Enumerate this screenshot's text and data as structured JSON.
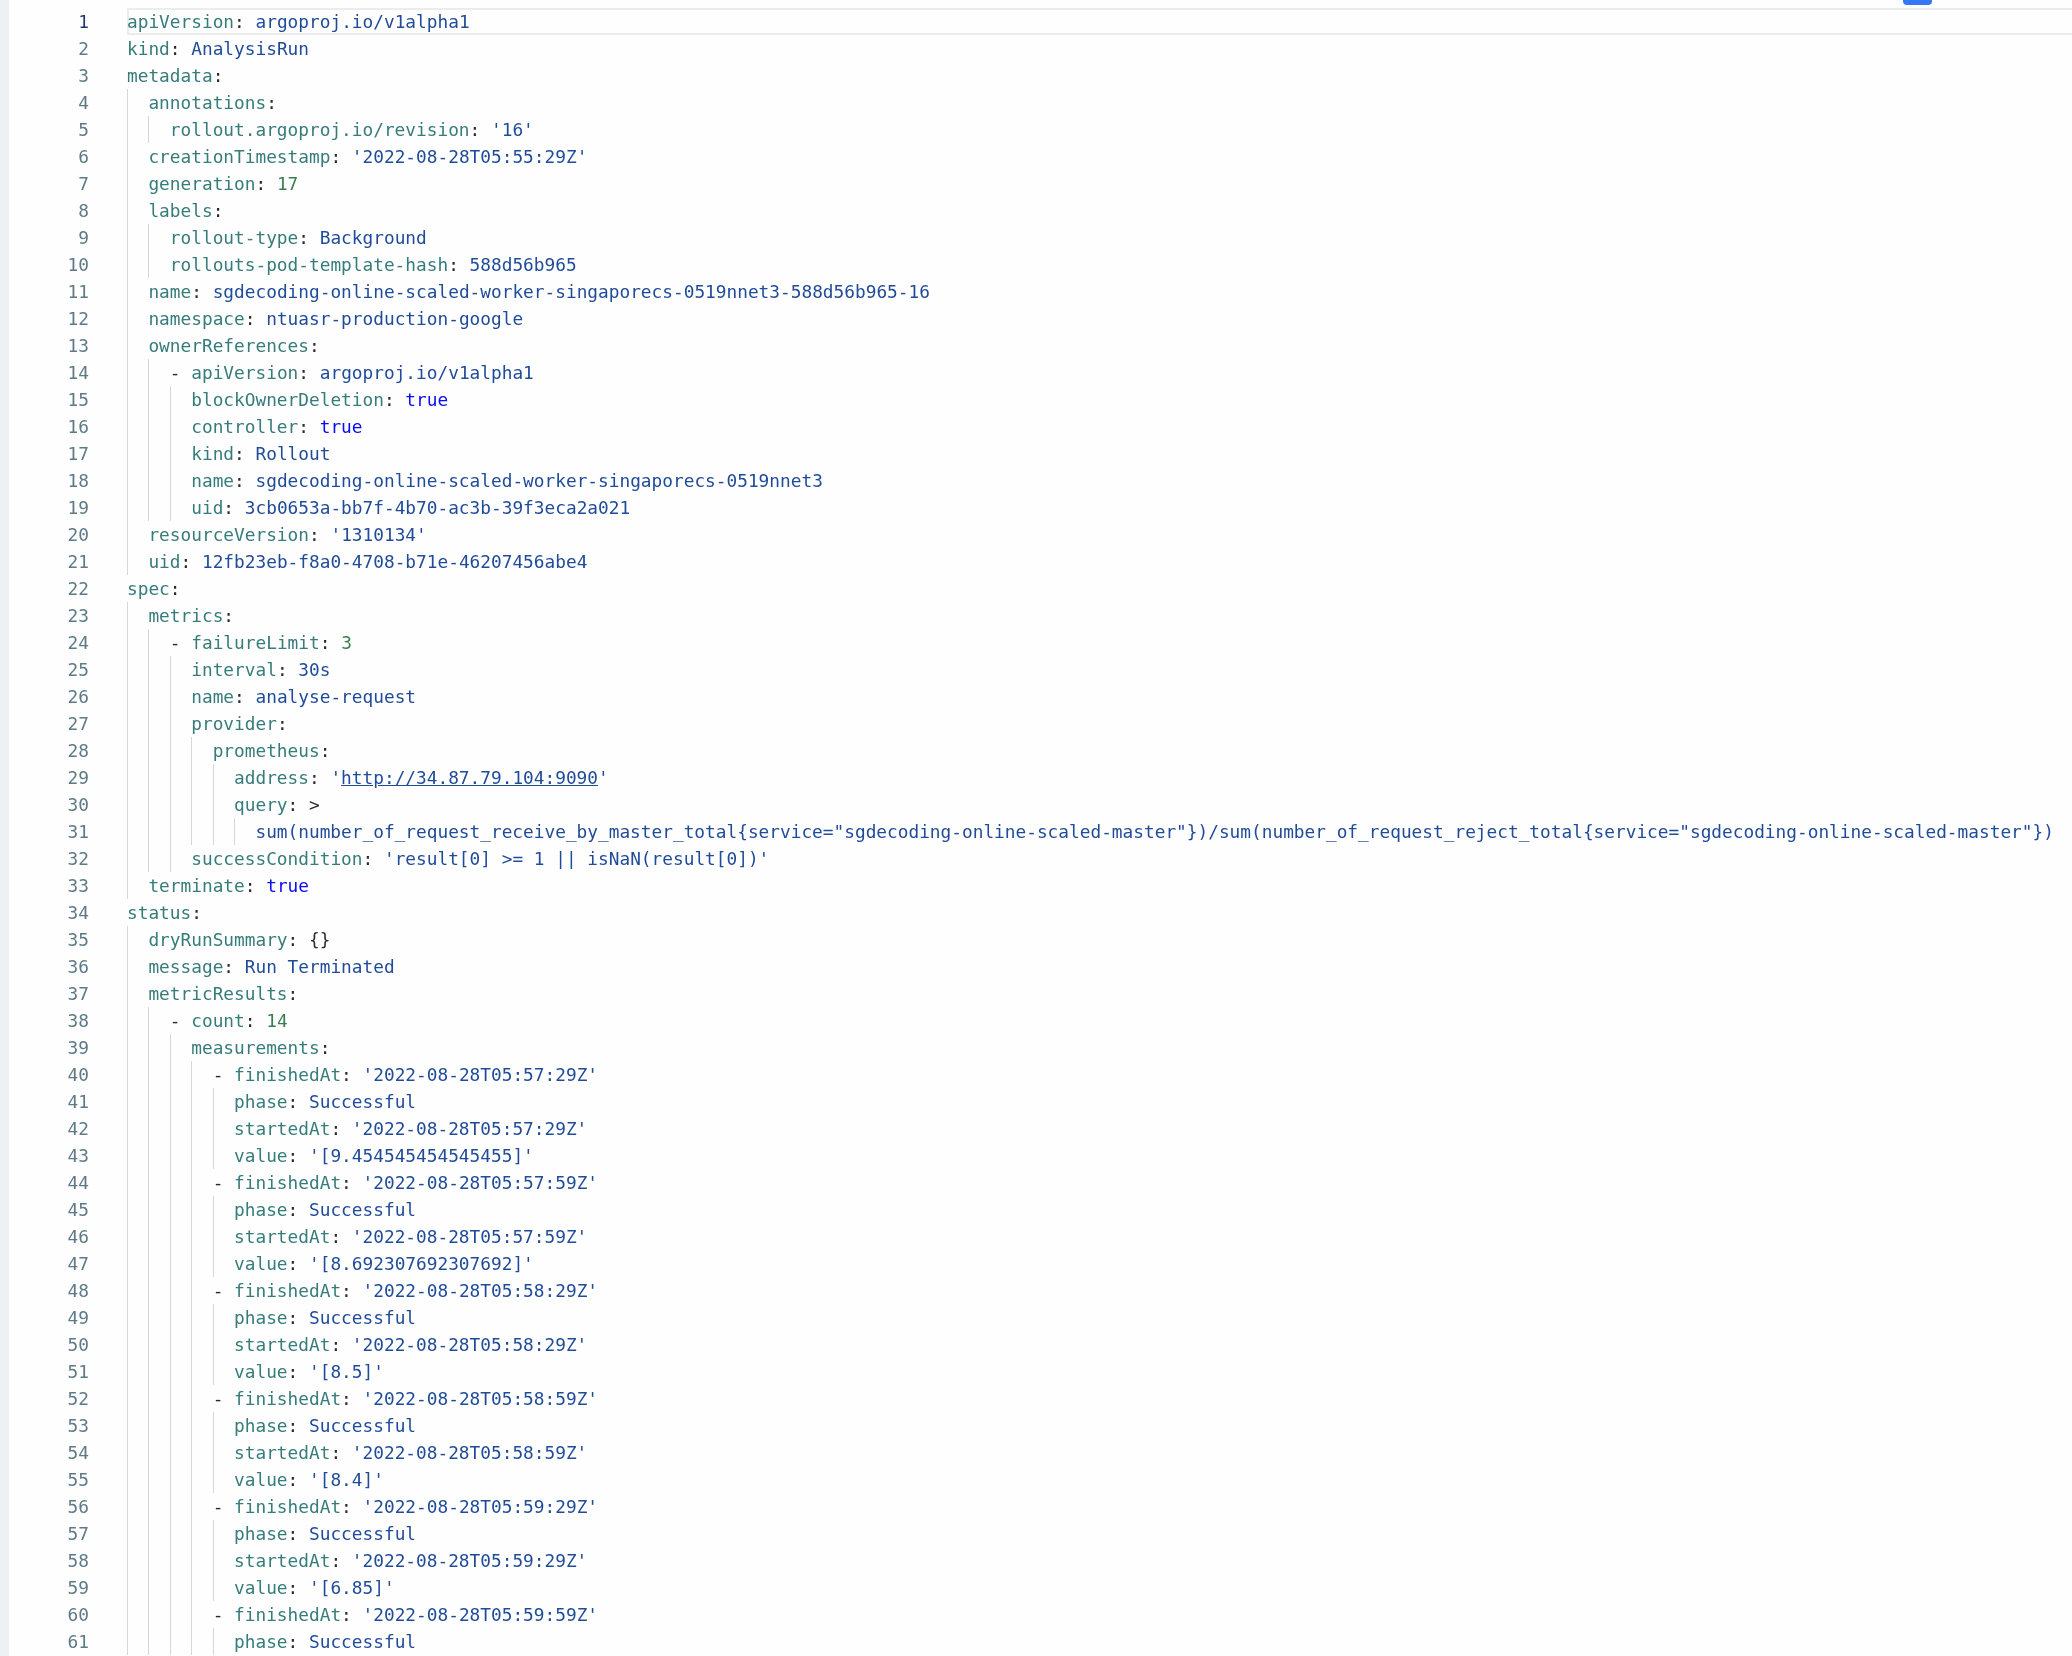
{
  "editor": {
    "lines": [
      {
        "number": "1",
        "selected": true,
        "tokens": [
          {
            "kind": "key",
            "text": "apiVersion"
          },
          {
            "kind": "punct",
            "text": ": "
          },
          {
            "kind": "string",
            "text": "argoproj.io/v1alpha1"
          }
        ]
      },
      {
        "number": "2",
        "selected": false,
        "tokens": [
          {
            "kind": "key",
            "text": "kind"
          },
          {
            "kind": "punct",
            "text": ": "
          },
          {
            "kind": "string",
            "text": "AnalysisRun"
          }
        ]
      },
      {
        "number": "3",
        "selected": false,
        "tokens": [
          {
            "kind": "key",
            "text": "metadata"
          },
          {
            "kind": "punct",
            "text": ":"
          }
        ]
      },
      {
        "number": "4",
        "selected": false,
        "tokens": [
          {
            "kind": "key",
            "text": "  annotations"
          },
          {
            "kind": "punct",
            "text": ":"
          }
        ]
      },
      {
        "number": "5",
        "selected": false,
        "tokens": [
          {
            "kind": "key",
            "text": "    rollout.argoproj.io/revision"
          },
          {
            "kind": "punct",
            "text": ": "
          },
          {
            "kind": "string",
            "text": "'16'"
          }
        ]
      },
      {
        "number": "6",
        "selected": false,
        "tokens": [
          {
            "kind": "key",
            "text": "  creationTimestamp"
          },
          {
            "kind": "punct",
            "text": ": "
          },
          {
            "kind": "string",
            "text": "'2022-08-28T05:55:29Z'"
          }
        ]
      },
      {
        "number": "7",
        "selected": false,
        "tokens": [
          {
            "kind": "key",
            "text": "  generation"
          },
          {
            "kind": "punct",
            "text": ": "
          },
          {
            "kind": "number",
            "text": "17"
          }
        ]
      },
      {
        "number": "8",
        "selected": false,
        "tokens": [
          {
            "kind": "key",
            "text": "  labels"
          },
          {
            "kind": "punct",
            "text": ":"
          }
        ]
      },
      {
        "number": "9",
        "selected": false,
        "tokens": [
          {
            "kind": "key",
            "text": "    rollout-type"
          },
          {
            "kind": "punct",
            "text": ": "
          },
          {
            "kind": "string",
            "text": "Background"
          }
        ]
      },
      {
        "number": "10",
        "selected": false,
        "tokens": [
          {
            "kind": "key",
            "text": "    rollouts-pod-template-hash"
          },
          {
            "kind": "punct",
            "text": ": "
          },
          {
            "kind": "string",
            "text": "588d56b965"
          }
        ]
      },
      {
        "number": "11",
        "selected": false,
        "tokens": [
          {
            "kind": "key",
            "text": "  name"
          },
          {
            "kind": "punct",
            "text": ": "
          },
          {
            "kind": "string",
            "text": "sgdecoding-online-scaled-worker-singaporecs-0519nnet3-588d56b965-16"
          }
        ]
      },
      {
        "number": "12",
        "selected": false,
        "tokens": [
          {
            "kind": "key",
            "text": "  namespace"
          },
          {
            "kind": "punct",
            "text": ": "
          },
          {
            "kind": "string",
            "text": "ntuasr-production-google"
          }
        ]
      },
      {
        "number": "13",
        "selected": false,
        "tokens": [
          {
            "kind": "key",
            "text": "  ownerReferences"
          },
          {
            "kind": "punct",
            "text": ":"
          }
        ]
      },
      {
        "number": "14",
        "selected": false,
        "tokens": [
          {
            "kind": "punct",
            "text": "    - "
          },
          {
            "kind": "key",
            "text": "apiVersion"
          },
          {
            "kind": "punct",
            "text": ": "
          },
          {
            "kind": "string",
            "text": "argoproj.io/v1alpha1"
          }
        ]
      },
      {
        "number": "15",
        "selected": false,
        "tokens": [
          {
            "kind": "key",
            "text": "      blockOwnerDeletion"
          },
          {
            "kind": "punct",
            "text": ": "
          },
          {
            "kind": "bool",
            "text": "true"
          }
        ]
      },
      {
        "number": "16",
        "selected": false,
        "tokens": [
          {
            "kind": "key",
            "text": "      controller"
          },
          {
            "kind": "punct",
            "text": ": "
          },
          {
            "kind": "bool",
            "text": "true"
          }
        ]
      },
      {
        "number": "17",
        "selected": false,
        "tokens": [
          {
            "kind": "key",
            "text": "      kind"
          },
          {
            "kind": "punct",
            "text": ": "
          },
          {
            "kind": "string",
            "text": "Rollout"
          }
        ]
      },
      {
        "number": "18",
        "selected": false,
        "tokens": [
          {
            "kind": "key",
            "text": "      name"
          },
          {
            "kind": "punct",
            "text": ": "
          },
          {
            "kind": "string",
            "text": "sgdecoding-online-scaled-worker-singaporecs-0519nnet3"
          }
        ]
      },
      {
        "number": "19",
        "selected": false,
        "tokens": [
          {
            "kind": "key",
            "text": "      uid"
          },
          {
            "kind": "punct",
            "text": ": "
          },
          {
            "kind": "string",
            "text": "3cb0653a-bb7f-4b70-ac3b-39f3eca2a021"
          }
        ]
      },
      {
        "number": "20",
        "selected": false,
        "tokens": [
          {
            "kind": "key",
            "text": "  resourceVersion"
          },
          {
            "kind": "punct",
            "text": ": "
          },
          {
            "kind": "string",
            "text": "'1310134'"
          }
        ]
      },
      {
        "number": "21",
        "selected": false,
        "tokens": [
          {
            "kind": "key",
            "text": "  uid"
          },
          {
            "kind": "punct",
            "text": ": "
          },
          {
            "kind": "string",
            "text": "12fb23eb-f8a0-4708-b71e-46207456abe4"
          }
        ]
      },
      {
        "number": "22",
        "selected": false,
        "tokens": [
          {
            "kind": "key",
            "text": "spec"
          },
          {
            "kind": "punct",
            "text": ":"
          }
        ]
      },
      {
        "number": "23",
        "selected": false,
        "tokens": [
          {
            "kind": "key",
            "text": "  metrics"
          },
          {
            "kind": "punct",
            "text": ":"
          }
        ]
      },
      {
        "number": "24",
        "selected": false,
        "tokens": [
          {
            "kind": "punct",
            "text": "    - "
          },
          {
            "kind": "key",
            "text": "failureLimit"
          },
          {
            "kind": "punct",
            "text": ": "
          },
          {
            "kind": "number",
            "text": "3"
          }
        ]
      },
      {
        "number": "25",
        "selected": false,
        "tokens": [
          {
            "kind": "key",
            "text": "      interval"
          },
          {
            "kind": "punct",
            "text": ": "
          },
          {
            "kind": "string",
            "text": "30s"
          }
        ]
      },
      {
        "number": "26",
        "selected": false,
        "tokens": [
          {
            "kind": "key",
            "text": "      name"
          },
          {
            "kind": "punct",
            "text": ": "
          },
          {
            "kind": "string",
            "text": "analyse-request"
          }
        ]
      },
      {
        "number": "27",
        "selected": false,
        "tokens": [
          {
            "kind": "key",
            "text": "      provider"
          },
          {
            "kind": "punct",
            "text": ":"
          }
        ]
      },
      {
        "number": "28",
        "selected": false,
        "tokens": [
          {
            "kind": "key",
            "text": "        prometheus"
          },
          {
            "kind": "punct",
            "text": ":"
          }
        ]
      },
      {
        "number": "29",
        "selected": false,
        "tokens": [
          {
            "kind": "key",
            "text": "          address"
          },
          {
            "kind": "punct",
            "text": ": "
          },
          {
            "kind": "string",
            "text": "'"
          },
          {
            "kind": "link",
            "text": "http://34.87.79.104:9090"
          },
          {
            "kind": "string",
            "text": "'"
          }
        ]
      },
      {
        "number": "30",
        "selected": false,
        "tokens": [
          {
            "kind": "key",
            "text": "          query"
          },
          {
            "kind": "punct",
            "text": ": >"
          }
        ]
      },
      {
        "number": "31",
        "selected": false,
        "tokens": [
          {
            "kind": "string",
            "text": "            sum(number_of_request_receive_by_master_total{service=\"sgdecoding-online-scaled-master\"})/sum(number_of_request_reject_total{service=\"sgdecoding-online-scaled-master\"})"
          }
        ]
      },
      {
        "number": "32",
        "selected": false,
        "tokens": [
          {
            "kind": "key",
            "text": "      successCondition"
          },
          {
            "kind": "punct",
            "text": ": "
          },
          {
            "kind": "string",
            "text": "'result[0] >= 1 || isNaN(result[0])'"
          }
        ]
      },
      {
        "number": "33",
        "selected": false,
        "tokens": [
          {
            "kind": "key",
            "text": "  terminate"
          },
          {
            "kind": "punct",
            "text": ": "
          },
          {
            "kind": "bool",
            "text": "true"
          }
        ]
      },
      {
        "number": "34",
        "selected": false,
        "tokens": [
          {
            "kind": "key",
            "text": "status"
          },
          {
            "kind": "punct",
            "text": ":"
          }
        ]
      },
      {
        "number": "35",
        "selected": false,
        "tokens": [
          {
            "kind": "key",
            "text": "  dryRunSummary"
          },
          {
            "kind": "punct",
            "text": ": {}"
          }
        ]
      },
      {
        "number": "36",
        "selected": false,
        "tokens": [
          {
            "kind": "key",
            "text": "  message"
          },
          {
            "kind": "punct",
            "text": ": "
          },
          {
            "kind": "string",
            "text": "Run Terminated"
          }
        ]
      },
      {
        "number": "37",
        "selected": false,
        "tokens": [
          {
            "kind": "key",
            "text": "  metricResults"
          },
          {
            "kind": "punct",
            "text": ":"
          }
        ]
      },
      {
        "number": "38",
        "selected": false,
        "tokens": [
          {
            "kind": "punct",
            "text": "    - "
          },
          {
            "kind": "key",
            "text": "count"
          },
          {
            "kind": "punct",
            "text": ": "
          },
          {
            "kind": "number",
            "text": "14"
          }
        ]
      },
      {
        "number": "39",
        "selected": false,
        "tokens": [
          {
            "kind": "key",
            "text": "      measurements"
          },
          {
            "kind": "punct",
            "text": ":"
          }
        ]
      },
      {
        "number": "40",
        "selected": false,
        "tokens": [
          {
            "kind": "punct",
            "text": "        - "
          },
          {
            "kind": "key",
            "text": "finishedAt"
          },
          {
            "kind": "punct",
            "text": ": "
          },
          {
            "kind": "string",
            "text": "'2022-08-28T05:57:29Z'"
          }
        ]
      },
      {
        "number": "41",
        "selected": false,
        "tokens": [
          {
            "kind": "key",
            "text": "          phase"
          },
          {
            "kind": "punct",
            "text": ": "
          },
          {
            "kind": "string",
            "text": "Successful"
          }
        ]
      },
      {
        "number": "42",
        "selected": false,
        "tokens": [
          {
            "kind": "key",
            "text": "          startedAt"
          },
          {
            "kind": "punct",
            "text": ": "
          },
          {
            "kind": "string",
            "text": "'2022-08-28T05:57:29Z'"
          }
        ]
      },
      {
        "number": "43",
        "selected": false,
        "tokens": [
          {
            "kind": "key",
            "text": "          value"
          },
          {
            "kind": "punct",
            "text": ": "
          },
          {
            "kind": "string",
            "text": "'[9.454545454545455]'"
          }
        ]
      },
      {
        "number": "44",
        "selected": false,
        "tokens": [
          {
            "kind": "punct",
            "text": "        - "
          },
          {
            "kind": "key",
            "text": "finishedAt"
          },
          {
            "kind": "punct",
            "text": ": "
          },
          {
            "kind": "string",
            "text": "'2022-08-28T05:57:59Z'"
          }
        ]
      },
      {
        "number": "45",
        "selected": false,
        "tokens": [
          {
            "kind": "key",
            "text": "          phase"
          },
          {
            "kind": "punct",
            "text": ": "
          },
          {
            "kind": "string",
            "text": "Successful"
          }
        ]
      },
      {
        "number": "46",
        "selected": false,
        "tokens": [
          {
            "kind": "key",
            "text": "          startedAt"
          },
          {
            "kind": "punct",
            "text": ": "
          },
          {
            "kind": "string",
            "text": "'2022-08-28T05:57:59Z'"
          }
        ]
      },
      {
        "number": "47",
        "selected": false,
        "tokens": [
          {
            "kind": "key",
            "text": "          value"
          },
          {
            "kind": "punct",
            "text": ": "
          },
          {
            "kind": "string",
            "text": "'[8.692307692307692]'"
          }
        ]
      },
      {
        "number": "48",
        "selected": false,
        "tokens": [
          {
            "kind": "punct",
            "text": "        - "
          },
          {
            "kind": "key",
            "text": "finishedAt"
          },
          {
            "kind": "punct",
            "text": ": "
          },
          {
            "kind": "string",
            "text": "'2022-08-28T05:58:29Z'"
          }
        ]
      },
      {
        "number": "49",
        "selected": false,
        "tokens": [
          {
            "kind": "key",
            "text": "          phase"
          },
          {
            "kind": "punct",
            "text": ": "
          },
          {
            "kind": "string",
            "text": "Successful"
          }
        ]
      },
      {
        "number": "50",
        "selected": false,
        "tokens": [
          {
            "kind": "key",
            "text": "          startedAt"
          },
          {
            "kind": "punct",
            "text": ": "
          },
          {
            "kind": "string",
            "text": "'2022-08-28T05:58:29Z'"
          }
        ]
      },
      {
        "number": "51",
        "selected": false,
        "tokens": [
          {
            "kind": "key",
            "text": "          value"
          },
          {
            "kind": "punct",
            "text": ": "
          },
          {
            "kind": "string",
            "text": "'[8.5]'"
          }
        ]
      },
      {
        "number": "52",
        "selected": false,
        "tokens": [
          {
            "kind": "punct",
            "text": "        - "
          },
          {
            "kind": "key",
            "text": "finishedAt"
          },
          {
            "kind": "punct",
            "text": ": "
          },
          {
            "kind": "string",
            "text": "'2022-08-28T05:58:59Z'"
          }
        ]
      },
      {
        "number": "53",
        "selected": false,
        "tokens": [
          {
            "kind": "key",
            "text": "          phase"
          },
          {
            "kind": "punct",
            "text": ": "
          },
          {
            "kind": "string",
            "text": "Successful"
          }
        ]
      },
      {
        "number": "54",
        "selected": false,
        "tokens": [
          {
            "kind": "key",
            "text": "          startedAt"
          },
          {
            "kind": "punct",
            "text": ": "
          },
          {
            "kind": "string",
            "text": "'2022-08-28T05:58:59Z'"
          }
        ]
      },
      {
        "number": "55",
        "selected": false,
        "tokens": [
          {
            "kind": "key",
            "text": "          value"
          },
          {
            "kind": "punct",
            "text": ": "
          },
          {
            "kind": "string",
            "text": "'[8.4]'"
          }
        ]
      },
      {
        "number": "56",
        "selected": false,
        "tokens": [
          {
            "kind": "punct",
            "text": "        - "
          },
          {
            "kind": "key",
            "text": "finishedAt"
          },
          {
            "kind": "punct",
            "text": ": "
          },
          {
            "kind": "string",
            "text": "'2022-08-28T05:59:29Z'"
          }
        ]
      },
      {
        "number": "57",
        "selected": false,
        "tokens": [
          {
            "kind": "key",
            "text": "          phase"
          },
          {
            "kind": "punct",
            "text": ": "
          },
          {
            "kind": "string",
            "text": "Successful"
          }
        ]
      },
      {
        "number": "58",
        "selected": false,
        "tokens": [
          {
            "kind": "key",
            "text": "          startedAt"
          },
          {
            "kind": "punct",
            "text": ": "
          },
          {
            "kind": "string",
            "text": "'2022-08-28T05:59:29Z'"
          }
        ]
      },
      {
        "number": "59",
        "selected": false,
        "tokens": [
          {
            "kind": "key",
            "text": "          value"
          },
          {
            "kind": "punct",
            "text": ": "
          },
          {
            "kind": "string",
            "text": "'[6.85]'"
          }
        ]
      },
      {
        "number": "60",
        "selected": false,
        "tokens": [
          {
            "kind": "punct",
            "text": "        - "
          },
          {
            "kind": "key",
            "text": "finishedAt"
          },
          {
            "kind": "punct",
            "text": ": "
          },
          {
            "kind": "string",
            "text": "'2022-08-28T05:59:59Z'"
          }
        ]
      },
      {
        "number": "61",
        "selected": false,
        "tokens": [
          {
            "kind": "key",
            "text": "          phase"
          },
          {
            "kind": "punct",
            "text": ": "
          },
          {
            "kind": "string",
            "text": "Successful"
          }
        ]
      }
    ]
  }
}
